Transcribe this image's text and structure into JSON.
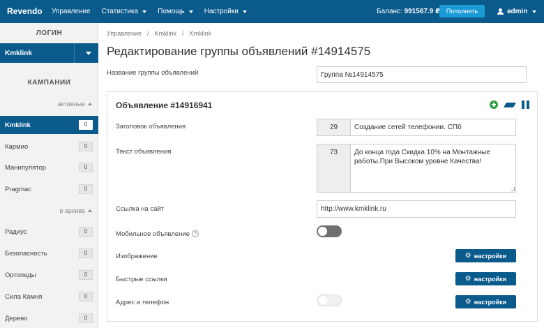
{
  "topbar": {
    "brand": "Revendo",
    "nav": [
      "Управление",
      "Статистика",
      "Помощь",
      "Настройки"
    ],
    "balance_label": "Баланс:",
    "balance_value": "991567.9 ₽",
    "topup_label": "Пополнить",
    "user": "admin"
  },
  "sidebar": {
    "login_heading": "ЛОГИН",
    "login_value": "Kmklink",
    "campaigns_heading": "КАМПАНИИ",
    "active_label": "активные",
    "archive_label": "в архиве",
    "active_items": [
      {
        "label": "Kmklink",
        "count": "0"
      },
      {
        "label": "Кармио",
        "count": "0"
      },
      {
        "label": "Манипулятор",
        "count": "0"
      },
      {
        "label": "Pragmac",
        "count": "0"
      }
    ],
    "archive_items": [
      {
        "label": "Радиус",
        "count": "0"
      },
      {
        "label": "Безопасность",
        "count": "0"
      },
      {
        "label": "Ортопеды",
        "count": "0"
      },
      {
        "label": "Сила Камня",
        "count": "0"
      },
      {
        "label": "Дерево",
        "count": "0"
      }
    ]
  },
  "main": {
    "breadcrumb": [
      "Управление",
      "/",
      "Kmklink",
      "/",
      "Kmklink"
    ],
    "title": "Редактирование группы объявлений #14914575",
    "group_name_label": "Название группы объявлений",
    "group_name_value": "Группа №14914575",
    "ad": {
      "title": "Объявление #14916941",
      "headline_label": "Заголовок объявления",
      "headline_count": "29",
      "headline_value": "Создание сетей телефонии. СПб",
      "text_label": "Текст объявления",
      "text_count": "73",
      "text_value": "До конца года Скидка 10% на Монтажные работы.При Высоком уровне Качества!",
      "url_label": "Ссылка на сайт",
      "url_value": "http://www.kmklink.ru",
      "mobile_label": "Мобильное объявление",
      "help_glyph": "?",
      "image_label": "Изображение",
      "quicklinks_label": "Быстрые ссылки",
      "address_label": "Адрес и телефон",
      "settings_label": "настройки"
    }
  }
}
